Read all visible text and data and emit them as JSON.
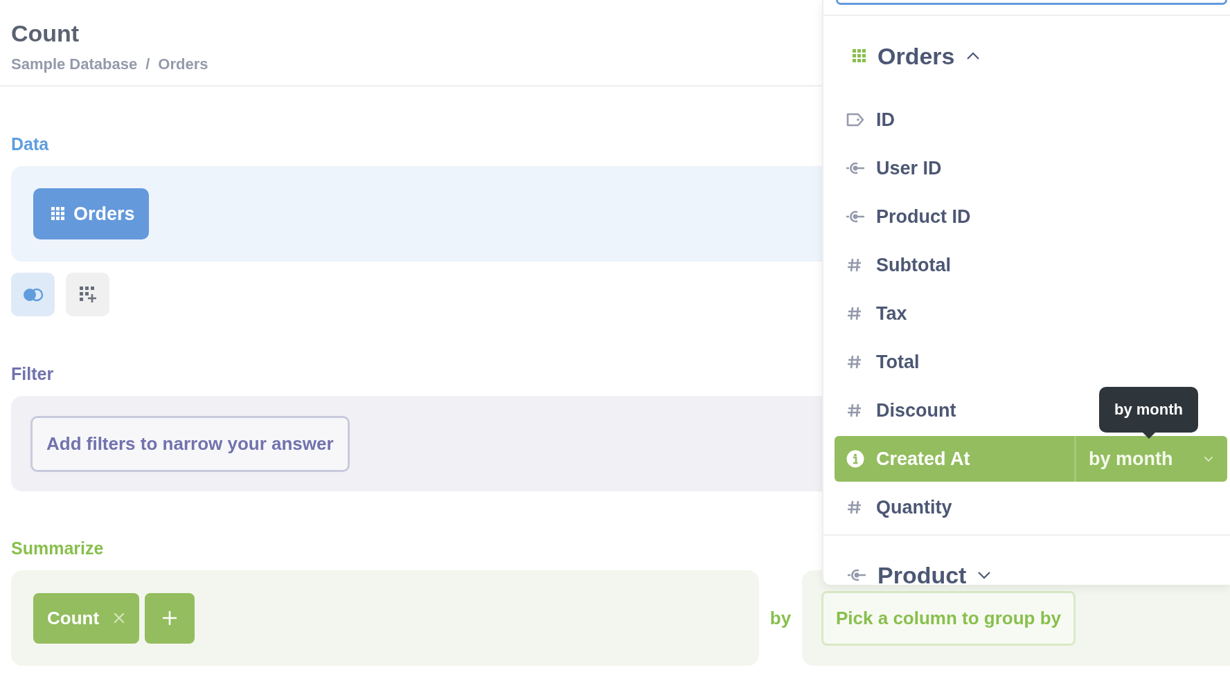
{
  "question": {
    "title": "Count",
    "breadcrumb": [
      "Sample Database",
      "Orders"
    ],
    "separator": "/"
  },
  "data": {
    "label": "Data",
    "table": "Orders"
  },
  "filter": {
    "label": "Filter",
    "button": "Add filters to narrow your answer"
  },
  "summarize": {
    "label": "Summarize",
    "metrics": [
      {
        "label": "Count"
      }
    ],
    "by": "by",
    "group_button": "Pick a column to group by"
  },
  "column_picker": {
    "tables": [
      {
        "name": "Orders",
        "kind": "table",
        "expanded": true,
        "columns": [
          {
            "name": "ID",
            "kind": "pk",
            "selected": false
          },
          {
            "name": "User ID",
            "kind": "fk",
            "selected": false
          },
          {
            "name": "Product ID",
            "kind": "fk",
            "selected": false
          },
          {
            "name": "Subtotal",
            "kind": "number",
            "selected": false
          },
          {
            "name": "Tax",
            "kind": "number",
            "selected": false
          },
          {
            "name": "Total",
            "kind": "number",
            "selected": false
          },
          {
            "name": "Discount",
            "kind": "number",
            "selected": false
          },
          {
            "name": "Created At",
            "kind": "date",
            "selected": true,
            "bucket": "by month",
            "tooltip": "by month"
          },
          {
            "name": "Quantity",
            "kind": "number",
            "selected": false
          }
        ]
      },
      {
        "name": "Product",
        "kind": "fk",
        "expanded": false
      }
    ]
  }
}
